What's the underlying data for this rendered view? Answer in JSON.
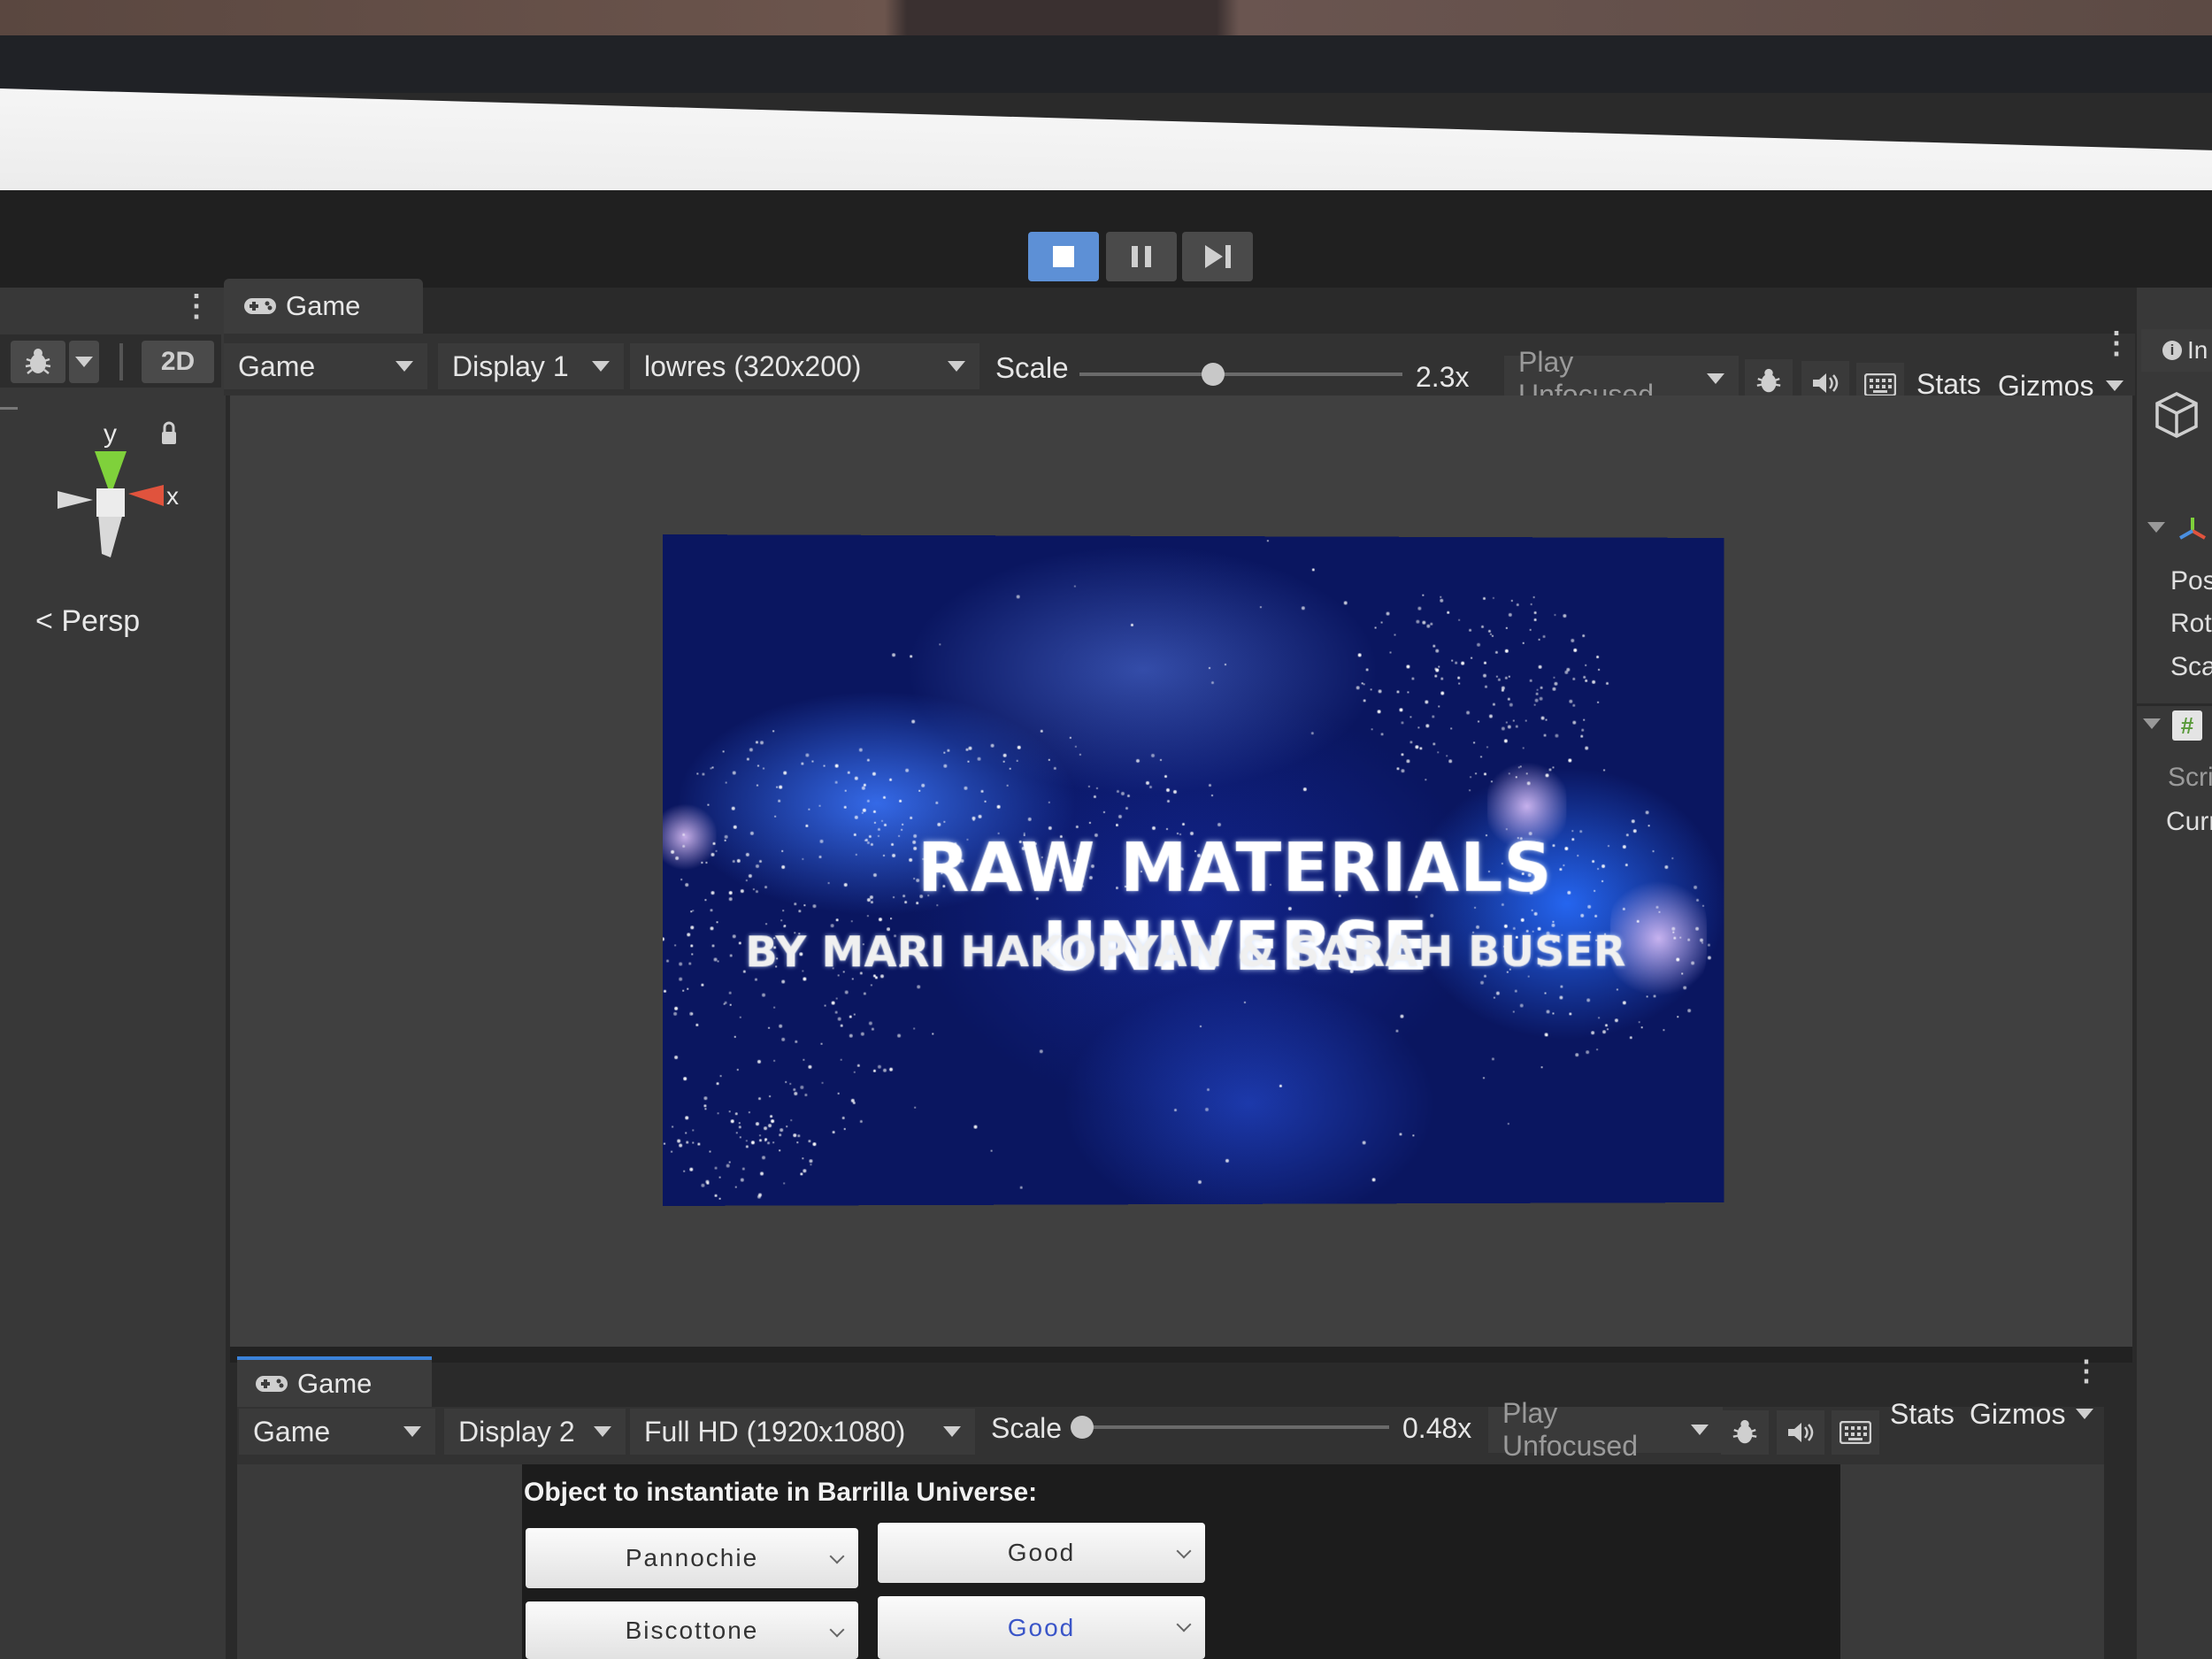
{
  "toolbar": {
    "play_label": "Play",
    "pause_label": "Pause",
    "step_label": "Step"
  },
  "scene_panel": {
    "twod_label": "2D",
    "gizmo_y": "y",
    "gizmo_x": "x",
    "persp_label": "Persp"
  },
  "game_view": {
    "tab_label": "Game",
    "view_dropdown": "Game",
    "display_dropdown": "Display 1",
    "resolution_dropdown": "lowres (320x200)",
    "scale_label": "Scale",
    "scale_value": "2.3x",
    "scale_fraction": 0.36,
    "play_mode_dropdown": "Play Unfocused",
    "stats_label": "Stats",
    "gizmos_label": "Gizmos",
    "screen": {
      "title": "RAW MATERIALS UNIVERSE",
      "subtitle": "BY MARI HAKOPYAN & SARAH BUSER"
    }
  },
  "inspector": {
    "tab_label": "In",
    "fields": [
      "Pos",
      "Rot",
      "Sca",
      "Scri",
      "Curr"
    ]
  },
  "game_view_2": {
    "tab_label": "Game",
    "view_dropdown": "Game",
    "display_dropdown": "Display 2",
    "resolution_dropdown": "Full HD (1920x1080)",
    "scale_label": "Scale",
    "scale_value": "0.48x",
    "scale_fraction": 0.0,
    "play_mode_dropdown": "Play Unfocused",
    "stats_label": "Stats",
    "gizmos_label": "Gizmos",
    "ui": {
      "instantiate_label": "Object to instantiate in Barrilla Universe:",
      "row1_object": "Pannochie",
      "row1_quality": "Good",
      "row2_object": "Biscottone",
      "row2_quality": "Good"
    }
  },
  "colors": {
    "accent_blue": "#5d90d6",
    "quality_blue": "#3a55c8",
    "gizmo_green": "#7fd13b",
    "gizmo_red": "#e0533d"
  }
}
